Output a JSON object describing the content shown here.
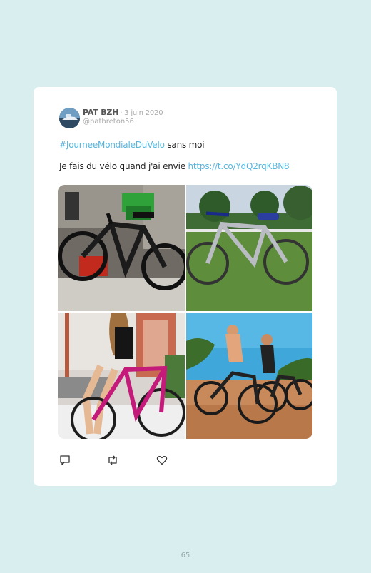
{
  "tweet": {
    "author_name": "PAT BZH",
    "date": "· 3 juin 2020",
    "handle": "@patbreton56",
    "hashtag": "#JourneeMondialeDuVelo",
    "hashtag_suffix": " sans moi",
    "text": "Je fais du vélo quand j'ai envie ",
    "link": "https://t.co/YdQ2rqKBN8"
  },
  "photos": [
    {
      "name": "black-ebike-in-garage-photo"
    },
    {
      "name": "folding-bike-on-grass-photo"
    },
    {
      "name": "woman-pink-road-bike-photo"
    },
    {
      "name": "two-women-mountain-bikes-photo"
    }
  ],
  "actions": {
    "reply_icon": "reply-icon",
    "retweet_icon": "retweet-icon",
    "like_icon": "heart-icon"
  },
  "page_number": "65"
}
